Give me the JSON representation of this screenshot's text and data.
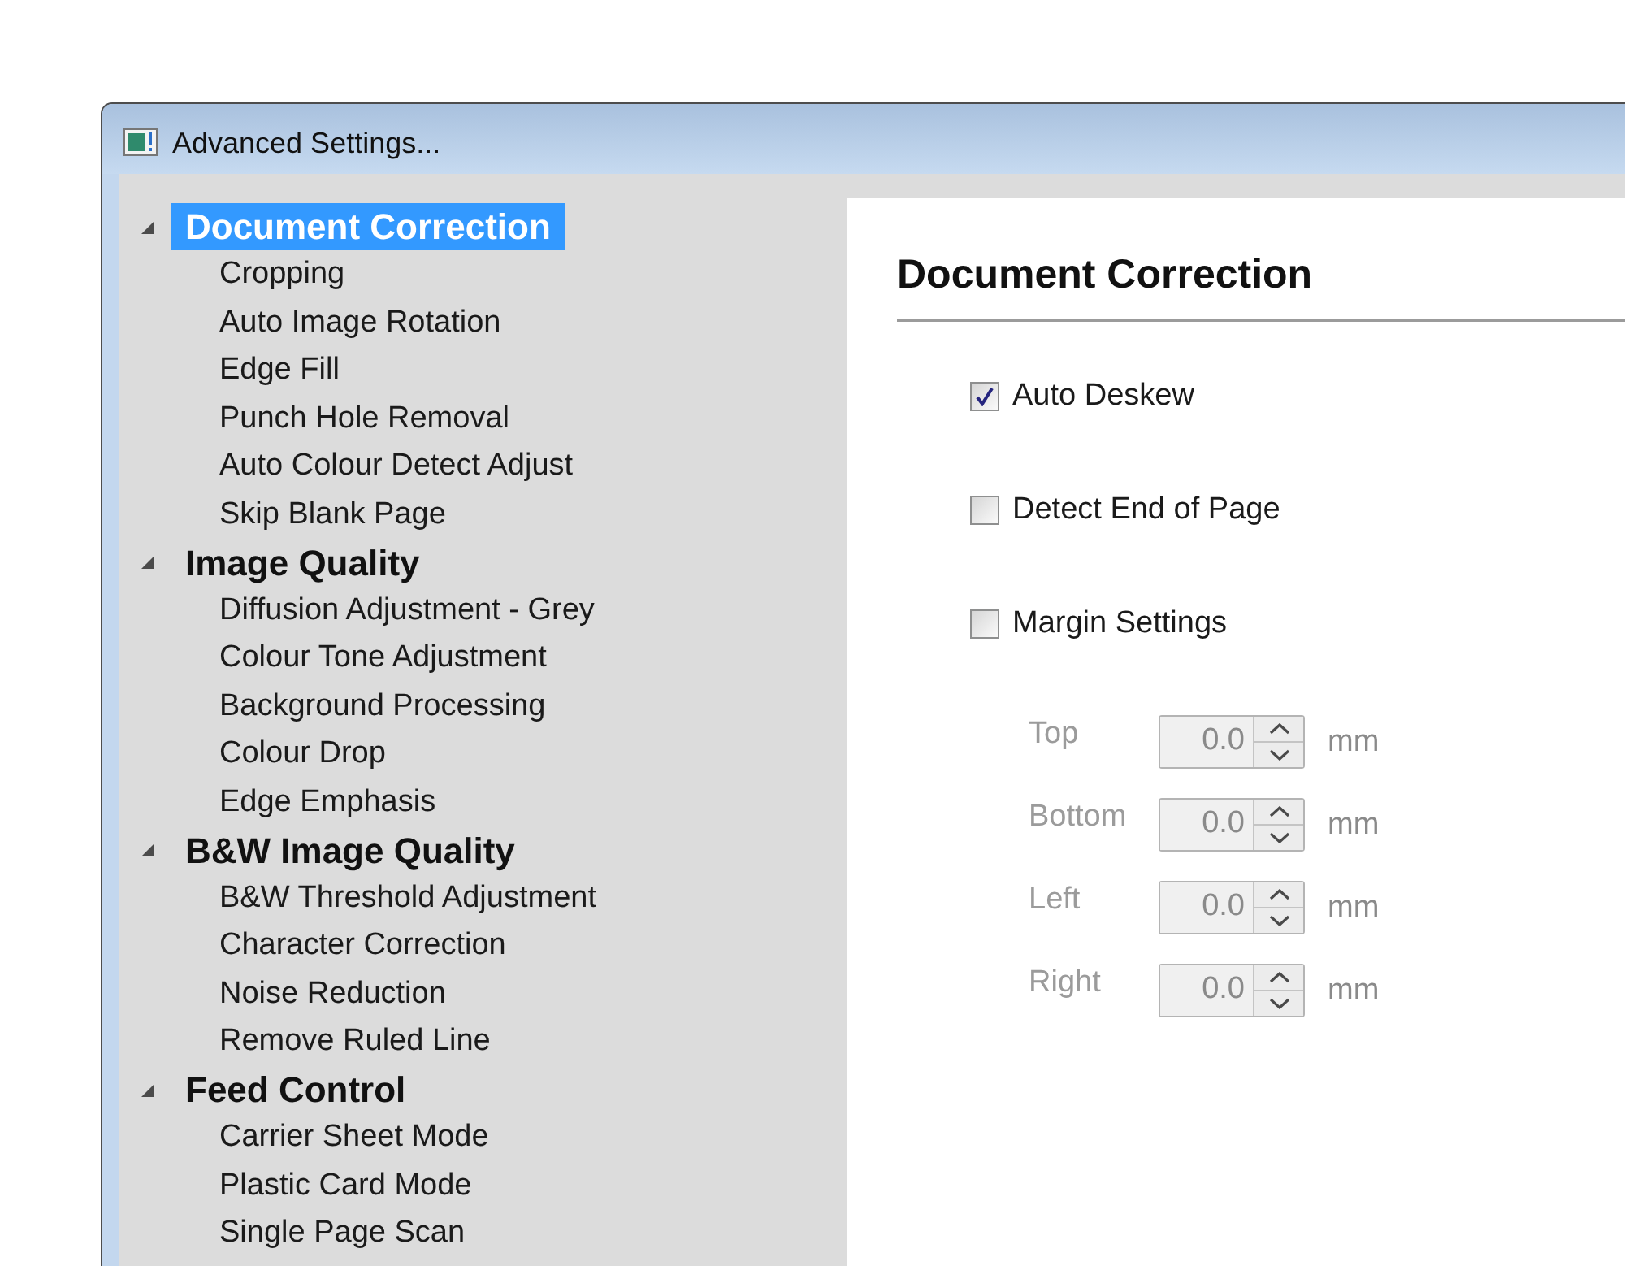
{
  "window": {
    "title": "Advanced Settings..."
  },
  "tree": [
    {
      "label": "Document Correction",
      "expanded": true,
      "selected": true,
      "children": [
        {
          "label": "Cropping",
          "selected": false
        },
        {
          "label": "Auto Image Rotation",
          "selected": false
        },
        {
          "label": "Edge Fill",
          "selected": false
        },
        {
          "label": "Punch Hole Removal",
          "selected": false
        },
        {
          "label": "Auto Colour Detect Adjust",
          "selected": false
        },
        {
          "label": "Skip Blank Page",
          "selected": false
        }
      ]
    },
    {
      "label": "Image Quality",
      "expanded": true,
      "selected": false,
      "children": [
        {
          "label": "Diffusion Adjustment - Grey",
          "selected": false
        },
        {
          "label": "Colour Tone Adjustment",
          "selected": false
        },
        {
          "label": "Background Processing",
          "selected": false
        },
        {
          "label": "Colour Drop",
          "selected": false
        },
        {
          "label": "Edge Emphasis",
          "selected": false
        }
      ]
    },
    {
      "label": "B&W Image Quality",
      "expanded": true,
      "selected": false,
      "children": [
        {
          "label": "B&W Threshold Adjustment",
          "selected": false
        },
        {
          "label": "Character Correction",
          "selected": false
        },
        {
          "label": "Noise Reduction",
          "selected": false
        },
        {
          "label": "Remove Ruled Line",
          "selected": false
        }
      ]
    },
    {
      "label": "Feed Control",
      "expanded": true,
      "selected": false,
      "children": [
        {
          "label": "Carrier Sheet Mode",
          "selected": false
        },
        {
          "label": "Plastic Card Mode",
          "selected": false
        },
        {
          "label": "Single Page Scan",
          "selected": false
        }
      ]
    }
  ],
  "panel": {
    "heading": "Document Correction",
    "options": [
      {
        "label": "Auto Deskew",
        "checked": true
      },
      {
        "label": "Detect End of Page",
        "checked": false
      },
      {
        "label": "Margin Settings",
        "checked": false
      }
    ],
    "margins": {
      "disabled": true,
      "fields": [
        {
          "label": "Top",
          "value": "0.0",
          "unit": "mm"
        },
        {
          "label": "Bottom",
          "value": "0.0",
          "unit": "mm"
        },
        {
          "label": "Left",
          "value": "0.0",
          "unit": "mm"
        },
        {
          "label": "Right",
          "value": "0.0",
          "unit": "mm"
        }
      ]
    }
  }
}
